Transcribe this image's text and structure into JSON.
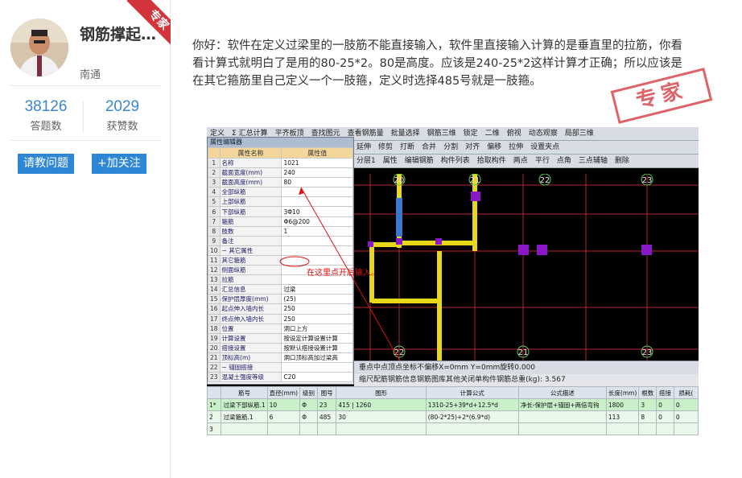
{
  "profile": {
    "name": "钢筋撑起…",
    "badge": "专家",
    "location": "南通",
    "stats": [
      {
        "value": "38126",
        "label": "答题数"
      },
      {
        "value": "2029",
        "label": "获赞数"
      }
    ],
    "ask_button": "请教问题",
    "follow_button": "+加关注"
  },
  "answer": {
    "text": "你好：软件在定义过梁里的一肢筋不能直接输入，软件里直接输入计算的是垂直里的拉筋，你看看计算式就明白了是用的80-25*2。80是高度。应该是240-25*2这样计算才正确；所以应该是在其它箍筋里自己定义一个一肢箍，定义时选择485号就是一肢箍。",
    "stamp": "专家"
  },
  "screenshot": {
    "toolbar1": [
      "定义",
      "Σ 汇总计算",
      "平齐板顶",
      "查找图元",
      "查看钢筋量",
      "批量选择",
      "钢筋三维",
      "锁定",
      "二维",
      "俯视",
      "动态观察",
      "局部三维"
    ],
    "toolbar2": [
      "延伸",
      "修剪",
      "打断",
      "合并",
      "分割",
      "对齐",
      "偏移",
      "拉伸",
      "设置夹点"
    ],
    "toolbar3": [
      "分层1",
      "属性",
      "编辑钢筋",
      "构件列表",
      "拾取构件",
      "两点",
      "平行",
      "点角",
      "三点辅轴",
      "删除"
    ],
    "prop_panel": {
      "title": "属性编辑器",
      "col_name": "属性名称",
      "col_value": "属性值",
      "rows": [
        {
          "i": "1",
          "name": "名称",
          "value": "1021"
        },
        {
          "i": "2",
          "name": "截面宽度(mm)",
          "value": "240"
        },
        {
          "i": "3",
          "name": "截面高度(mm)",
          "value": "80"
        },
        {
          "i": "4",
          "name": "全部纵筋",
          "value": ""
        },
        {
          "i": "5",
          "name": "上部纵筋",
          "value": ""
        },
        {
          "i": "6",
          "name": "下部纵筋",
          "value": "3Φ10"
        },
        {
          "i": "7",
          "name": "箍筋",
          "value": "Φ6@200"
        },
        {
          "i": "8",
          "name": "肢数",
          "value": "1"
        },
        {
          "i": "9",
          "name": "备注",
          "value": ""
        },
        {
          "i": "10",
          "name": "− 其它属性",
          "value": ""
        },
        {
          "i": "11",
          "name": "其它箍筋",
          "value": ""
        },
        {
          "i": "12",
          "name": "侧面纵筋",
          "value": ""
        },
        {
          "i": "13",
          "name": "拉筋",
          "value": ""
        },
        {
          "i": "14",
          "name": "汇总信息",
          "value": "过梁"
        },
        {
          "i": "15",
          "name": "保护层厚度(mm)",
          "value": "(25)"
        },
        {
          "i": "16",
          "name": "起点伸入墙内长",
          "value": "250"
        },
        {
          "i": "17",
          "name": "终点伸入墙内长",
          "value": "250"
        },
        {
          "i": "18",
          "name": "位置",
          "value": "洞口上方"
        },
        {
          "i": "19",
          "name": "计算设置",
          "value": "按设定计算设置计算"
        },
        {
          "i": "20",
          "name": "搭接设置",
          "value": "按默认搭接设置计算"
        },
        {
          "i": "21",
          "name": "顶标高(m)",
          "value": "洞口顶标高加过梁高"
        },
        {
          "i": "22",
          "name": "− 锚固搭接",
          "value": ""
        },
        {
          "i": "23",
          "name": "混凝土强度等级",
          "value": "C20"
        }
      ]
    },
    "annotation": "在这里点开后输入。",
    "grid_labels": [
      "20",
      "21",
      "22",
      "23",
      "21",
      "22",
      "23"
    ],
    "bottom_bar1": [
      "垂点",
      "中点",
      "顶点",
      "坐标",
      "不偏移",
      "X=",
      "0",
      "mm Y=",
      "0",
      "mm",
      "旋转",
      "0.000"
    ],
    "bottom_bar2": [
      "缩尺配筋",
      "钢筋信息",
      "钢筋图库",
      "其他",
      "关闭",
      "单构件钢筋总重(kg): 3.567"
    ],
    "rebar_table": {
      "headers": [
        "",
        "筋号",
        "直径(mm)",
        "级别",
        "图号",
        "图形",
        "计算公式",
        "公式描述",
        "长度(mm)",
        "根数",
        "搭接",
        "损耗("
      ],
      "rows": [
        [
          "1*",
          "过梁下部纵筋.1",
          "10",
          "Φ",
          "23",
          "415 | 1260",
          "1310-25+39*d+12.5*d",
          "净长-保护层+锚固+两倍弯钩",
          "1800",
          "3",
          "0",
          "0"
        ],
        [
          "2",
          "过梁箍筋.1",
          "6",
          "Φ",
          "485",
          "30",
          "(80-2*25)+2*(6.9*d)",
          "",
          "113",
          "8",
          "0",
          "0"
        ],
        [
          "3",
          "",
          "",
          "",
          "",
          "",
          "",
          "",
          "",
          "",
          "",
          ""
        ]
      ]
    }
  }
}
